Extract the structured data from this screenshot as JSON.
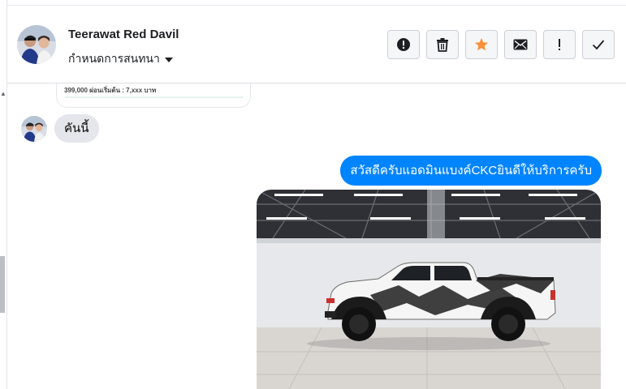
{
  "header": {
    "contact_name": "Teerawat Red Davil",
    "classify_label": "กำหนดการสนทนา",
    "actions": [
      {
        "label": "Mark as spam",
        "icon": "exclamation-circle-icon"
      },
      {
        "label": "Delete",
        "icon": "trash-icon"
      },
      {
        "label": "Star",
        "icon": "star-icon"
      },
      {
        "label": "Mark as unread",
        "icon": "envelope-icon"
      },
      {
        "label": "Follow up",
        "icon": "exclamation-icon"
      },
      {
        "label": "Mark as done",
        "icon": "checkmark-icon"
      }
    ]
  },
  "conversation": {
    "previous_card_text": "399,000 ผ่อนเริ่มต้น : 7,xxx บาท",
    "incoming_message": "คันนี้",
    "outgoing_message": "สวัสดีครับแอดมินแบงค์CKCยินดีให้บริการครับ",
    "photo": "white-pickup-truck-photo"
  },
  "colors": {
    "outgoing_bubble": "#0084ff",
    "incoming_bubble": "#e4e6eb",
    "star": "#f7923a"
  }
}
